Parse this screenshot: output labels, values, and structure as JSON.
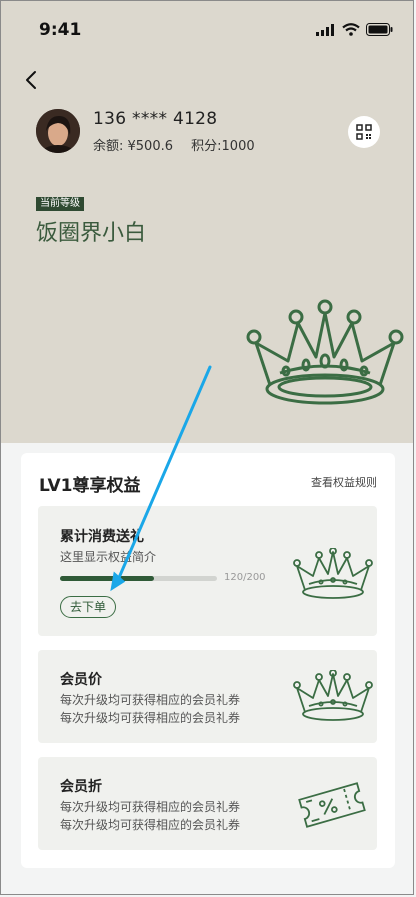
{
  "status_bar": {
    "time": "9:41"
  },
  "user": {
    "phone": "136 **** 4128",
    "balance": "余额: ¥500.6",
    "points": "积分:1000"
  },
  "level": {
    "tag": "当前等级",
    "name": "饭圈界小白"
  },
  "benefits": {
    "title": "LV1尊享权益",
    "rules_link": "查看权益规则",
    "items": [
      {
        "title": "累计消费送礼",
        "desc": "这里显示权益简介",
        "progress_text": "120/200",
        "progress_fraction": 0.6,
        "button": "去下单"
      },
      {
        "title": "会员价",
        "desc_line1": "每次升级均可获得相应的会员礼券",
        "desc_line2": "每次升级均可获得相应的会员礼券"
      },
      {
        "title": "会员折",
        "desc_line1": "每次升级均可获得相应的会员礼券",
        "desc_line2": "每次升级均可获得相应的会员礼券"
      }
    ]
  },
  "colors": {
    "hero_bg": "#dcd8ce",
    "accent_green": "#2f5a37",
    "annotation_arrow": "#1aa7e8"
  },
  "icons": [
    "back-icon",
    "qr-code-icon",
    "crown-icon",
    "coupon-icon"
  ]
}
